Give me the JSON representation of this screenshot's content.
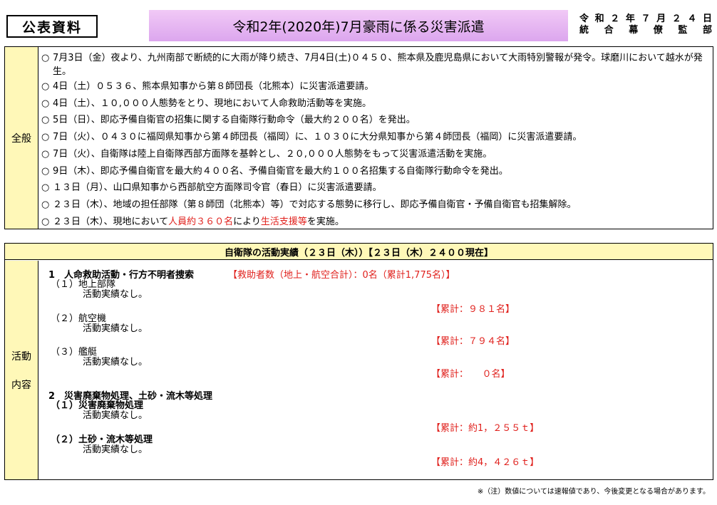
{
  "header": {
    "label": "公表資料",
    "title": "令和2年(2020年)7月豪雨に係る災害派遣",
    "date": "令和２年７月２４日",
    "issuer": "統合幕僚監部"
  },
  "overview": {
    "heading": "全般",
    "items": [
      {
        "bullet": "○",
        "text": "7月3日（金）夜より、九州南部で断続的に大雨が降り続き、7月4日(土)０４５０、熊本県及鹿児島県において大雨特別警報が発令。球磨川において越水が発生。"
      },
      {
        "bullet": "○",
        "text": "4日（土）０５３６、熊本県知事から第８師団長（北熊本）に災害派遣要請。"
      },
      {
        "bullet": "○",
        "text": "4日（土）、１０,０００人態勢をとり、現地において人命救助活動等を実施。"
      },
      {
        "bullet": "○",
        "text": "5日（日）、即応予備自衛官の招集に関する自衛隊行動命令（最大約２００名）を発出。"
      },
      {
        "bullet": "○",
        "text": "7日（火）、０４３０に福岡県知事から第４師団長（福岡）に、１０３０に大分県知事から第４師団長（福岡）に災害派遣要請。"
      },
      {
        "bullet": "○",
        "text": "7日（火）、自衛隊は陸上自衛隊西部方面隊を基幹とし、２０,０００人態勢をもって災害派遣活動を実施。"
      },
      {
        "bullet": "○",
        "text": "9日（木）、即応予備自衛官を最大約４００名、予備自衛官を最大約１００名招集する自衛隊行動命令を発出。"
      },
      {
        "bullet": "○",
        "text": "１３日（月）、山口県知事から西部航空方面隊司令官（春日）に災害派遣要請。"
      },
      {
        "bullet": "○",
        "text": "２３日（木）、地域の担任部隊（第８師団（北熊本）等）で対応する態勢に移行し、即応予備自衛官・予備自衛官も招集解除。"
      }
    ],
    "last_item": {
      "bullet": "○",
      "prefix": "２３日（木）、現地において",
      "red1": "人員約３６０名",
      "mid": "により",
      "red2": "生活支援等",
      "suffix": "を実施。"
    }
  },
  "activity": {
    "header": "自衛隊の活動実績（２３日（木））【２３日（木）２４００現在】",
    "side_label_1": "活動",
    "side_label_2": "内容",
    "section1": {
      "title": "1　人命救助活動・行方不明者捜索",
      "summary": "【救助者数（地上・航空合計）：0名（累計1,775名）】",
      "sub1_title": "（１）地上部隊",
      "sub1_note": "活動実績なし。",
      "sub1_total": "【累計：９８１名】",
      "sub2_title": "（２）航空機",
      "sub2_note": "活動実績なし。",
      "sub2_total": "【累計：７９４名】",
      "sub3_title": "（３）艦艇",
      "sub3_note": "活動実績なし。",
      "sub3_total": "【累計：　　０名】"
    },
    "section2": {
      "title": "2　災害廃棄物処理、土砂・流木等処理",
      "sub1_title": "（１）災害廃棄物処理",
      "sub1_note": "活動実績なし。",
      "sub1_total": "【累計：約1，２５５ｔ】",
      "sub2_title": "（２）土砂・流木等処理",
      "sub2_note": "活動実績なし。",
      "sub2_total": "【累計：約4，４２６ｔ】"
    }
  },
  "footnote": "※（注）数値については速報値であり、今後変更となる場合があります。",
  "colors": {
    "title_bg": "#dca6ee",
    "heading_bg": "#fff8b8",
    "emphasis_red": "#e0201c"
  }
}
